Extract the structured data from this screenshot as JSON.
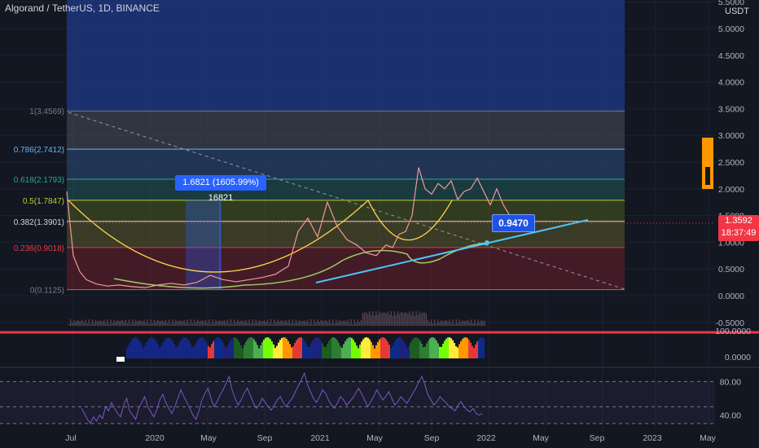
{
  "header": {
    "title": "Algorand / TetherUS, 1D, BINANCE",
    "currency": "USDT"
  },
  "price_badge": {
    "price": "1.3592",
    "countdown": "18:37:49"
  },
  "measure_label": "1.6821 (1605.99%) 16821",
  "callout_label": "0.9470",
  "colors": {
    "background": "#131722",
    "grid": "#1e2230",
    "red": "#f23645",
    "blue": "#2962ff",
    "rsi": "#7e57c2"
  },
  "chart_data": [
    {
      "type": "line",
      "title": "",
      "x_labels": [
        "Jul",
        "2020",
        "May",
        "Sep",
        "2021",
        "May",
        "Sep",
        "2022",
        "May",
        "Sep",
        "2023",
        "May"
      ],
      "price_axis": {
        "ticks": [
          "5.5000",
          "5.0000",
          "4.5000",
          "4.0000",
          "3.5000",
          "3.0000",
          "2.5000",
          "2.0000",
          "1.5000",
          "1.0000",
          "0.5000",
          "0.0000",
          "-0.5000"
        ],
        "ylim": [
          -0.55,
          5.55
        ]
      },
      "fib_levels": [
        {
          "label": "1(3.4569)",
          "ratio": "1",
          "value": 3.4569,
          "color": "#787b86"
        },
        {
          "label": "0.786(2.7412)",
          "ratio": "0.786",
          "value": 2.7412,
          "color": "#64b5f6"
        },
        {
          "label": "0.618(2.1793)",
          "ratio": "0.618",
          "value": 2.1793,
          "color": "#26a69a"
        },
        {
          "label": "0.5(1.7847)",
          "ratio": "0.5",
          "value": 1.7847,
          "color": "#c0ca33"
        },
        {
          "label": "0.382(1.3901)",
          "ratio": "0.382",
          "value": 1.3901,
          "color": "#d1d4dc"
        },
        {
          "label": "0.236(0.9018)",
          "ratio": "0.236",
          "value": 0.9018,
          "color": "#f23645"
        },
        {
          "label": "0(0.1125)",
          "ratio": "0",
          "value": 0.1125,
          "color": "#787b86"
        }
      ],
      "series": [
        {
          "t": [
            0,
            4,
            8,
            12,
            18,
            25,
            32,
            40,
            48,
            56,
            64,
            72,
            80,
            88,
            96,
            104,
            112,
            120,
            128,
            136,
            142,
            148,
            154,
            160,
            166,
            172,
            178,
            184,
            190,
            196,
            200,
            204,
            208,
            212,
            216,
            220,
            224,
            228,
            232,
            236,
            240,
            244,
            248,
            252,
            256,
            260,
            264,
            268,
            272,
            276,
            280
          ],
          "values": [
            1.95,
            0.75,
            0.45,
            0.3,
            0.22,
            0.18,
            0.2,
            0.17,
            0.15,
            0.2,
            0.23,
            0.2,
            0.25,
            0.38,
            0.3,
            0.26,
            0.3,
            0.34,
            0.4,
            0.55,
            1.2,
            1.45,
            1.1,
            1.75,
            1.3,
            1.05,
            0.95,
            0.8,
            0.75,
            0.95,
            0.9,
            1.15,
            1.2,
            1.5,
            2.4,
            2.0,
            1.9,
            2.1,
            2.0,
            2.15,
            1.8,
            1.95,
            2.0,
            2.2,
            1.95,
            1.7,
            2.0,
            1.7,
            1.5,
            1.4,
            1.36
          ]
        }
      ]
    },
    {
      "type": "bar",
      "title": "",
      "oscillator_axis": {
        "ticks": [
          "100.0000",
          "0.0000"
        ]
      }
    },
    {
      "type": "line",
      "title": "",
      "rsi_axis": {
        "ticks": [
          "80.00",
          "40.00"
        ],
        "ylim": [
          25,
          95
        ]
      },
      "values": [
        48,
        42,
        35,
        30,
        38,
        33,
        40,
        36,
        50,
        45,
        55,
        48,
        42,
        38,
        52,
        60,
        45,
        40,
        35,
        48,
        55,
        62,
        50,
        44,
        38,
        46,
        58,
        65,
        55,
        48,
        42,
        50,
        60,
        70,
        62,
        55,
        48,
        40,
        35,
        45,
        58,
        66,
        72,
        60,
        50,
        56,
        64,
        70,
        78,
        86,
        70,
        60,
        52,
        58,
        66,
        72,
        64,
        55,
        48,
        52,
        60,
        55,
        50,
        46,
        52,
        58,
        62,
        55,
        50,
        56,
        60,
        68,
        75,
        82,
        90,
        76,
        68,
        60,
        55,
        62,
        70,
        66,
        58,
        52,
        48,
        55,
        62,
        58,
        52,
        56,
        60,
        66,
        72,
        65,
        58,
        50,
        56,
        62,
        70,
        64,
        58,
        62,
        68,
        60,
        52,
        56,
        62,
        58,
        54,
        60,
        66,
        72,
        80,
        86,
        76,
        64,
        58,
        52,
        56,
        62,
        58,
        55,
        50,
        48,
        45,
        52,
        56,
        50,
        46,
        44,
        48,
        42,
        40,
        42
      ]
    }
  ]
}
